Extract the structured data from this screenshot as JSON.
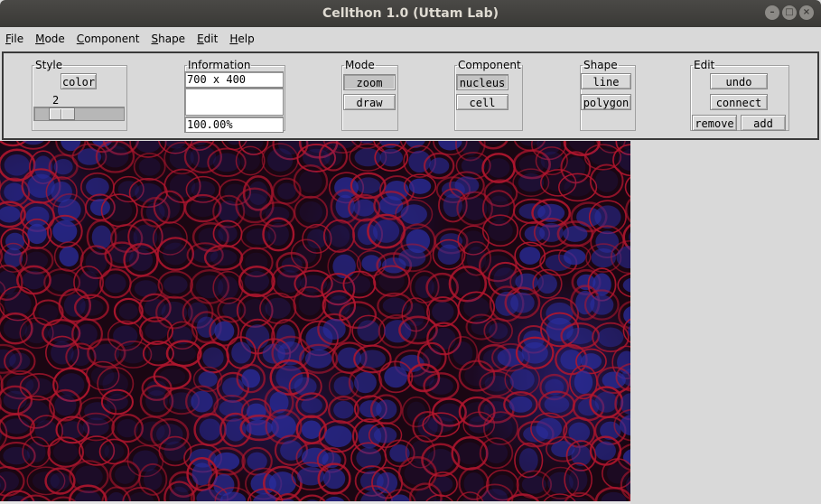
{
  "window": {
    "title": "Cellthon 1.0 (Uttam Lab)",
    "controls": {
      "minimize": "–",
      "maximize": "□",
      "close": "×"
    }
  },
  "menu": [
    {
      "hotkey": "F",
      "rest": "ile"
    },
    {
      "hotkey": "M",
      "rest": "ode"
    },
    {
      "hotkey": "C",
      "rest": "omponent"
    },
    {
      "hotkey": "S",
      "rest": "hape"
    },
    {
      "hotkey": "E",
      "rest": "dit"
    },
    {
      "hotkey": "H",
      "rest": "elp"
    }
  ],
  "style": {
    "legend": "Style",
    "color_label": "color",
    "slider_value": "2",
    "slider_fraction": 0.2
  },
  "information": {
    "legend": "Information",
    "dimensions": "700 x 400",
    "middle": "",
    "zoom": "100.00%"
  },
  "mode": {
    "legend": "Mode",
    "zoom_label": "zoom",
    "draw_label": "draw",
    "active": "zoom"
  },
  "component": {
    "legend": "Component",
    "nucleus_label": "nucleus",
    "cell_label": "cell",
    "active": "nucleus"
  },
  "shape": {
    "legend": "Shape",
    "line_label": "line",
    "polygon_label": "polygon"
  },
  "edit": {
    "legend": "Edit",
    "undo_label": "undo",
    "connect_label": "connect",
    "remove_label": "remove",
    "add_label": "add"
  },
  "colors": {
    "membrane": "#b0162e",
    "nucleus": "#2a2ea0",
    "background": "#1a0612"
  }
}
